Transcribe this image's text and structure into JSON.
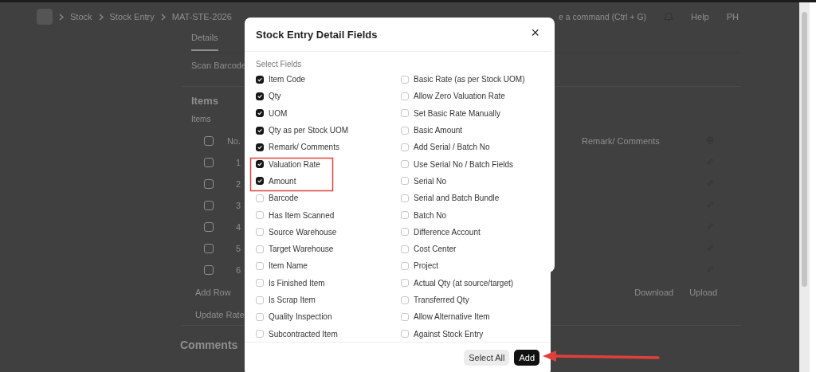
{
  "background_page": {
    "breadcrumbs": [
      "Stock",
      "Stock Entry",
      "MAT-STE-2026"
    ],
    "search": {
      "placeholder": "e a command (Ctrl + G)"
    },
    "help_menu": "Help",
    "avatar": "PH",
    "tabs": [
      {
        "label": "Details",
        "selected": true
      }
    ],
    "scan_label": "Scan Barcode",
    "section_title": "Items",
    "table_label": "Items",
    "table": {
      "header_checked": false,
      "columns": [
        "No.",
        "Remark/ Comments"
      ],
      "rows": [
        {
          "no": "1",
          "checked": false
        },
        {
          "no": "2",
          "checked": false
        },
        {
          "no": "3",
          "checked": false
        },
        {
          "no": "4",
          "checked": false
        },
        {
          "no": "5",
          "checked": false
        },
        {
          "no": "6",
          "checked": false
        }
      ]
    },
    "add_row": "Add Row",
    "download": "Download",
    "upload": "Upload",
    "update_rate": "Update Rate",
    "comments_title": "Comments"
  },
  "dialog": {
    "title": "Stock Entry Detail Fields",
    "close": "×",
    "section_label": "Select Fields",
    "field_columns": [
      {
        "fields": [
          {
            "label": "Item Code",
            "checked": true
          },
          {
            "label": "Qty",
            "checked": true
          },
          {
            "label": "UOM",
            "checked": true
          },
          {
            "label": "Qty as per Stock UOM",
            "checked": true
          },
          {
            "label": "Remark/ Comments",
            "checked": true
          },
          {
            "label": "Valuation Rate",
            "checked": true
          },
          {
            "label": "Amount",
            "checked": true
          },
          {
            "label": "Barcode",
            "checked": false
          },
          {
            "label": "Has Item Scanned",
            "checked": false
          },
          {
            "label": "Source Warehouse",
            "checked": false
          },
          {
            "label": "Target Warehouse",
            "checked": false
          },
          {
            "label": "Item Name",
            "checked": false
          },
          {
            "label": "Is Finished Item",
            "checked": false
          },
          {
            "label": "Is Scrap Item",
            "checked": false
          },
          {
            "label": "Quality Inspection",
            "checked": false
          },
          {
            "label": "Subcontracted Item",
            "checked": false
          }
        ]
      },
      {
        "fields": [
          {
            "label": "Basic Rate (as per Stock UOM)",
            "checked": false
          },
          {
            "label": "Allow Zero Valuation Rate",
            "checked": false
          },
          {
            "label": "Set Basic Rate Manually",
            "checked": false
          },
          {
            "label": "Basic Amount",
            "checked": false
          },
          {
            "label": "Add Serial / Batch No",
            "checked": false
          },
          {
            "label": "Use Serial No / Batch Fields",
            "checked": false
          },
          {
            "label": "Serial No",
            "checked": false
          },
          {
            "label": "Serial and Batch Bundle",
            "checked": false
          },
          {
            "label": "Batch No",
            "checked": false
          },
          {
            "label": "Difference Account",
            "checked": false
          },
          {
            "label": "Cost Center",
            "checked": false
          },
          {
            "label": "Project",
            "checked": false
          },
          {
            "label": "Actual Qty (at source/target)",
            "checked": false
          },
          {
            "label": "Transferred Qty",
            "checked": false
          },
          {
            "label": "Allow Alternative Item",
            "checked": false
          },
          {
            "label": "Against Stock Entry",
            "checked": false
          }
        ]
      }
    ],
    "buttons": [
      {
        "label": "Select All",
        "kind": "secondary"
      },
      {
        "label": "Add",
        "kind": "primary"
      }
    ]
  }
}
